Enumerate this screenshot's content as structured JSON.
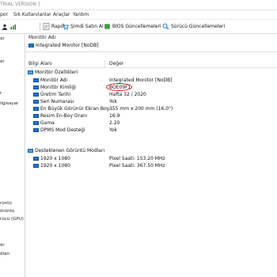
{
  "window": {
    "title_fragment": "TRIAL VERSION ]"
  },
  "menubar": {
    "items": [
      "por",
      "Sık Kullanılanlar",
      "Araçlar",
      "Yardım"
    ]
  },
  "toolbar": {
    "report_label": "Rapor",
    "buy_label": "Şimdi Satın Al",
    "bios_label": "BIOS Güncellemeleri",
    "driver_label": "Sürücü Güncellemeleri"
  },
  "sidebar": {
    "top_label": "ar",
    "items": [
      "er",
      "r",
      "ilgisayar",
      "",
      "rüntü",
      "örüntü",
      "rücü (GPU)",
      "",
      "ör",
      "dları"
    ]
  },
  "description": {
    "title": "Monitör Adı",
    "value": "Integrated Monitor [NoDB]"
  },
  "grid": {
    "headers": {
      "field": "Bilgi Alanı",
      "value": "Değer"
    },
    "groups": [
      {
        "title": "Monitör Özellikleri",
        "rows": [
          {
            "field": "Monitör Adı",
            "value": "Integrated Monitor [NoDB]"
          },
          {
            "field": "Monitör Kimliği",
            "value": "BOE09F1"
          },
          {
            "field": "Üretim Tarihi",
            "value": "Hafta 32 / 2020"
          },
          {
            "field": "Seri Numarası",
            "value": "Yok"
          },
          {
            "field": "En Büyük Görünür Ekran Boy...",
            "value": "355 mm x 200 mm (16.0\")"
          },
          {
            "field": "Resim En-Boy Oranı",
            "value": "16:9"
          },
          {
            "field": "Gama",
            "value": "2.20"
          },
          {
            "field": "DPMS Mod Desteği",
            "value": "Yok"
          }
        ]
      },
      {
        "title": "Desteklenen Görüntü Modları",
        "rows": [
          {
            "field": "1920 x 1080",
            "value": "Pixel Saati: 153.20 MHz"
          },
          {
            "field": "1920 x 1080",
            "value": "Pixel Saati: 367.50 MHz"
          }
        ]
      }
    ]
  },
  "colors": {
    "highlight": "#d71920",
    "accent_blue": "#1c77d1"
  }
}
